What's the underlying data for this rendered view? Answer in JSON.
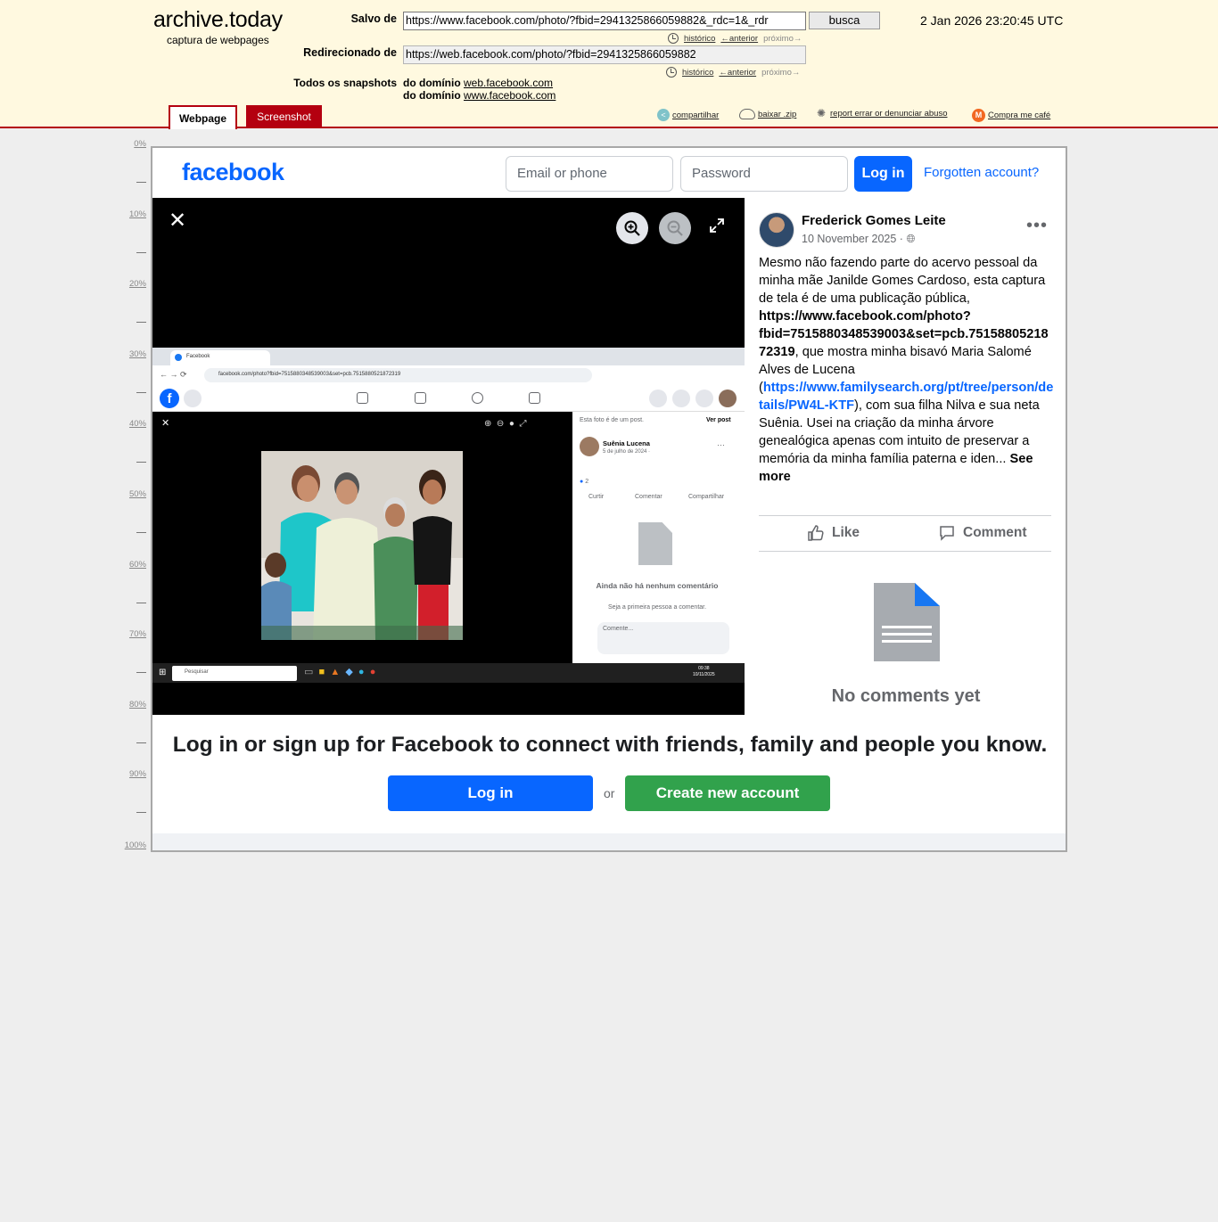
{
  "archive": {
    "logo": "archive.today",
    "subtitle": "captura de webpages",
    "saved_label": "Salvo de",
    "saved_url": "https://www.facebook.com/photo/?fbid=2941325866059882&_rdc=1&_rdr",
    "search_button": "busca",
    "datetime": "2 Jan 2026 23:20:45 UTC",
    "redirect_label": "Redirecionado de",
    "redirect_url": "https://web.facebook.com/photo/?fbid=2941325866059882",
    "history_link": "histórico",
    "prev_link": "←anterior",
    "next_link": "próximo→",
    "all_snapshots_label": "Todos os snapshots",
    "domain_prefix": "do domínio",
    "domain1": "web.facebook.com",
    "domain2": "www.facebook.com",
    "tabs": {
      "webpage": "Webpage",
      "screenshot": "Screenshot"
    },
    "tools": {
      "share": "compartilhar",
      "download": "baixar .zip",
      "report": "report errar or denunciar abuso",
      "coffee": "Compra me café"
    },
    "ruler": [
      "0%",
      "10%",
      "20%",
      "30%",
      "40%",
      "50%",
      "60%",
      "70%",
      "80%",
      "90%",
      "100%"
    ],
    "colors": {
      "header_bg": "#fff9e0",
      "accent_red": "#b40010"
    }
  },
  "facebook": {
    "logo": "facebook",
    "email_placeholder": "Email or phone",
    "password_placeholder": "Password",
    "login_button": "Log in",
    "forgot_link": "Forgotten account?",
    "post": {
      "author": "Frederick Gomes Leite",
      "date": "10 November 2025",
      "text_before": "Mesmo não fazendo parte do acervo pessoal da minha mãe Janilde Gomes Cardoso, esta captura de tela é de uma publicação pública, ",
      "text_link_bold": "https://www.facebook.com/photo?fbid=7515880348539003&set=pcb.7515880521872319",
      "text_middle": ", que mostra minha bisavó Maria Salomé Alves de Lucena (",
      "text_link": "https://www.familysearch.org/pt/tree/person/details/PW4L-KTF",
      "text_after": "), com sua filha Nilva e sua neta Suênia. Usei na criação da minha árvore genealógica apenas com intuito de preservar a memória da minha família paterna e iden... ",
      "see_more": "See more",
      "like": "Like",
      "comment": "Comment",
      "no_comments": "No comments yet"
    },
    "embedded": {
      "tab_title": "Facebook",
      "address": "facebook.com/photo?fbid=7515880348539003&set=pcb.7515880521872319",
      "photo_note": "Esta foto é de um post.",
      "see_post": "Ver post",
      "author": "Suênia Lucena",
      "date": "5 de julho de 2024 · ",
      "reactions": "2",
      "like": "Curtir",
      "comment": "Comentar",
      "share": "Compartilhar",
      "no_comments_title": "Ainda não há nenhum comentário",
      "no_comments_sub": "Seja a primeira pessoa a comentar.",
      "comment_placeholder": "Comente...",
      "taskbar_search": "Pesquisar",
      "clock_time": "09:38",
      "clock_date": "10/11/2025"
    },
    "banner": {
      "title": "Log in or sign up for Facebook to connect with friends, family and people you know.",
      "login": "Log in",
      "or": "or",
      "create": "Create new account"
    },
    "colors": {
      "brand_blue": "#0866ff",
      "create_green": "#31a24c"
    }
  }
}
